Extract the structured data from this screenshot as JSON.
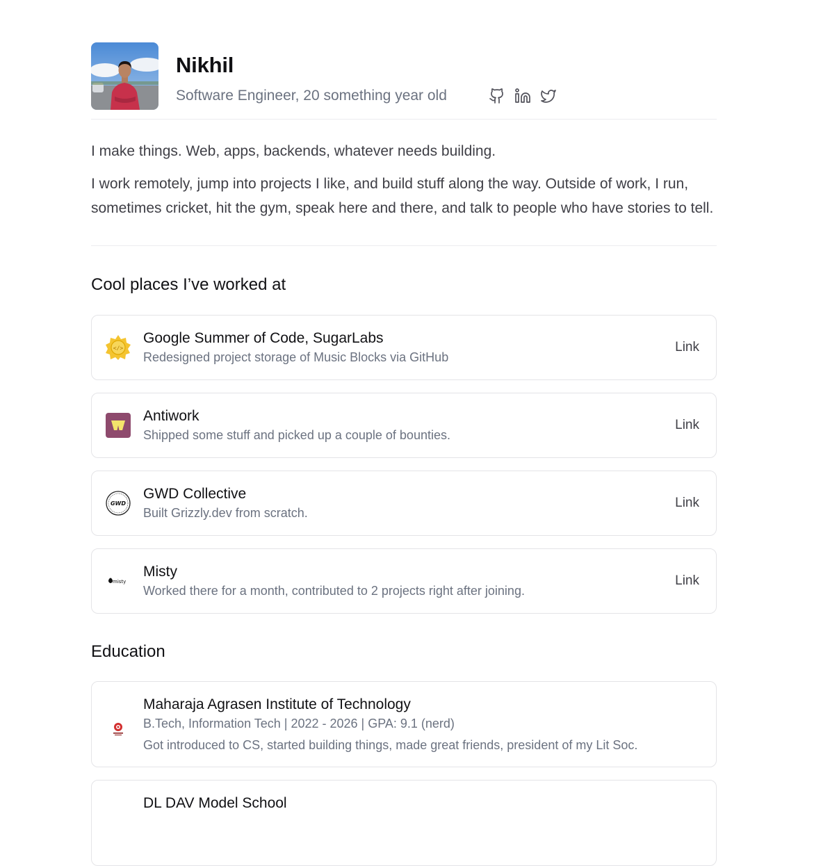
{
  "profile": {
    "name": "Nikhil",
    "tagline": "Software Engineer, 20 something year old",
    "socials": [
      {
        "icon": "github-icon",
        "label": "GitHub"
      },
      {
        "icon": "linkedin-icon",
        "label": "LinkedIn"
      },
      {
        "icon": "twitter-icon",
        "label": "Twitter"
      }
    ]
  },
  "bio": {
    "p1": "I make things. Web, apps, backends, whatever needs building.",
    "p2": "I work remotely, jump into projects I like, and build stuff along the way. Outside of work, I run, sometimes cricket, hit the gym, speak here and there, and talk to people who have stories to tell."
  },
  "work": {
    "title": "Cool places I’ve worked at",
    "items": [
      {
        "title": "Google Summer of Code, SugarLabs",
        "desc": "Redesigned project storage of Music Blocks via GitHub",
        "link": "Link",
        "logo": "gsoc-logo"
      },
      {
        "title": "Antiwork",
        "desc": "Shipped some stuff and picked up a couple of bounties.",
        "link": "Link",
        "logo": "antiwork-logo"
      },
      {
        "title": "GWD Collective",
        "desc": "Built Grizzly.dev from scratch.",
        "link": "Link",
        "logo": "gwd-logo"
      },
      {
        "title": "Misty",
        "desc": "Worked there for a month, contributed to 2 projects right after joining.",
        "link": "Link",
        "logo": "misty-logo"
      }
    ]
  },
  "education": {
    "title": "Education",
    "items": [
      {
        "title": "Maharaja Agrasen Institute of Technology",
        "meta": "B.Tech, Information Tech | 2022 - 2026 | GPA: 9.1 (nerd)",
        "note": "Got introduced to CS, started building things, made great friends, president of my Lit Soc."
      },
      {
        "title": "DL DAV Model School"
      }
    ]
  },
  "logo_text": {
    "gwd": "GWD",
    "misty": "misty"
  },
  "colors": {
    "text": "#111114",
    "muted": "#6b7280",
    "border": "#e4e4e7",
    "gsoc_yellow": "#f4c430",
    "antiwork_purple": "#8e4a6d"
  }
}
